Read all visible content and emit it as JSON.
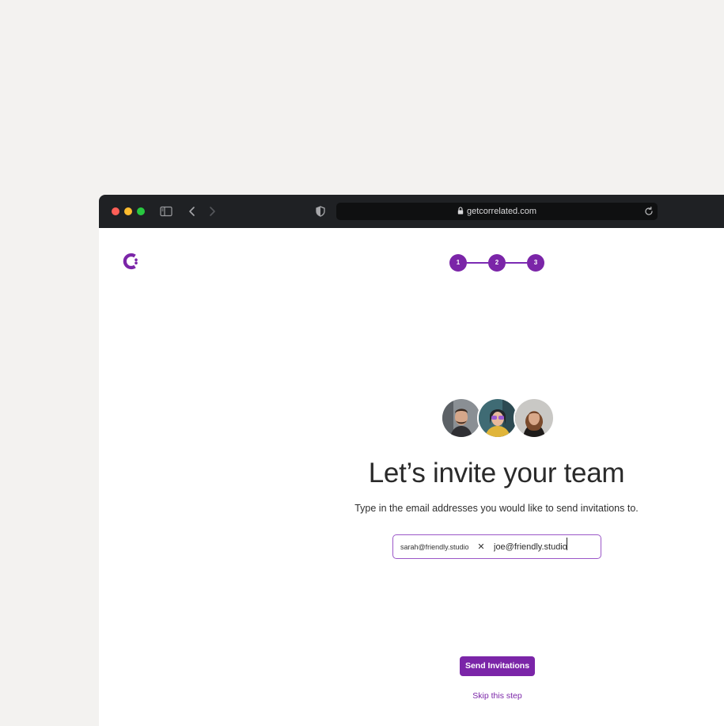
{
  "browser": {
    "url": "getcorrelated.com",
    "colors": {
      "toolbar": "#1f2124",
      "urlbar": "#0f1011"
    },
    "icons": [
      "close-dot-icon",
      "minimize-dot-icon",
      "zoom-dot-icon",
      "sidebar-icon",
      "back-icon",
      "forward-icon",
      "shield-icon",
      "lock-icon",
      "reload-icon"
    ]
  },
  "app": {
    "logo_icon": "correlated-logo-icon",
    "accent_color": "#7b25a8",
    "steps": [
      {
        "label": "1"
      },
      {
        "label": "2"
      },
      {
        "label": "3"
      }
    ],
    "title": "Let’s invite your team",
    "subtitle": "Type in the email addresses you would like to send invitations to.",
    "email_field": {
      "chips": [
        {
          "email": "sarah@friendly.studio",
          "remove_icon": "close-icon"
        }
      ],
      "current_value": "joe@friendly.studio"
    },
    "send_button_label": "Send Invitations",
    "skip_link_label": "Skip this step"
  }
}
